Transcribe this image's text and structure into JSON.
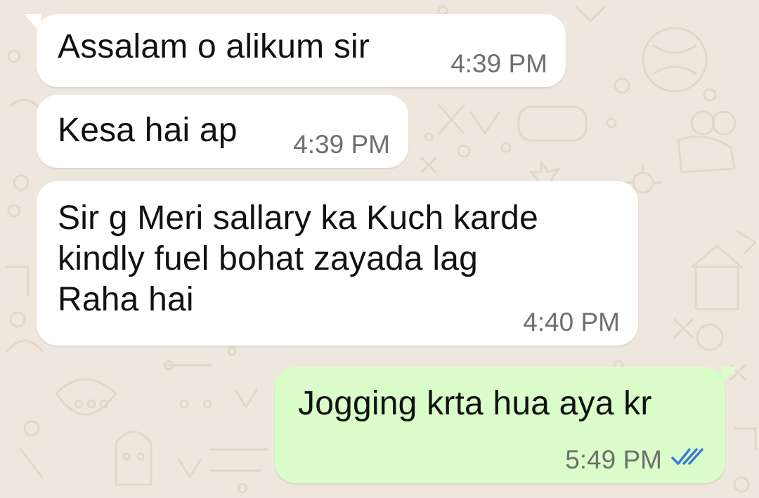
{
  "chat": {
    "messages": [
      {
        "direction": "incoming",
        "text": "Assalam o alikum sir",
        "time": "4:39 PM"
      },
      {
        "direction": "incoming",
        "text": "Kesa hai ap",
        "time": "4:39 PM"
      },
      {
        "direction": "incoming",
        "text": "Sir g Meri sallary ka Kuch karde\nkindly fuel bohat zayada lag\nRaha hai",
        "time": "4:40 PM"
      },
      {
        "direction": "outgoing",
        "text": "Jogging krta hua aya kr",
        "time": "5:49 PM",
        "status": "read"
      }
    ]
  },
  "colors": {
    "background": "#efe7de",
    "incoming_bubble": "#ffffff",
    "outgoing_bubble": "#dafdc9",
    "time_text": "#6f6f6f",
    "read_ticks": "#3a7bd5"
  },
  "icons": {
    "read_receipt": "double-check-icon"
  }
}
